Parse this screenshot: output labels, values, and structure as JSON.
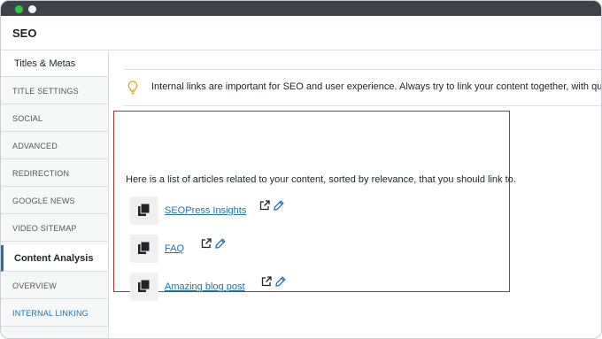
{
  "window": {
    "controls": [
      "close",
      "maximize"
    ]
  },
  "header": {
    "title": "SEO"
  },
  "sidebar": {
    "items": [
      {
        "label": "Titles & Metas",
        "kind": "section"
      },
      {
        "label": "TITLE SETTINGS",
        "kind": "sub"
      },
      {
        "label": "SOCIAL",
        "kind": "sub"
      },
      {
        "label": "ADVANCED",
        "kind": "sub"
      },
      {
        "label": "REDIRECTION",
        "kind": "sub"
      },
      {
        "label": "GOOGLE NEWS",
        "kind": "sub"
      },
      {
        "label": "VIDEO SITEMAP",
        "kind": "sub"
      },
      {
        "label": "Content Analysis",
        "kind": "section",
        "active": true
      },
      {
        "label": "OVERVIEW",
        "kind": "sub"
      },
      {
        "label": "INTERNAL LINKING",
        "kind": "sub",
        "selected": true
      }
    ]
  },
  "notice": {
    "icon": "lightbulb-icon",
    "text": "Internal links are important for SEO and user experience. Always try to link your content together, with quality"
  },
  "related": {
    "intro": "Here is a list of articles related to your content, sorted by relevance, that you should link to.",
    "articles": [
      {
        "title": "SEOPress Insights"
      },
      {
        "title": "FAQ"
      },
      {
        "title": "Amazing blog post"
      }
    ]
  },
  "colors": {
    "accent": "#2271b1",
    "highlight_border": "#c2272d",
    "titlebar": "#3d4349",
    "bulb": "#dba617"
  }
}
